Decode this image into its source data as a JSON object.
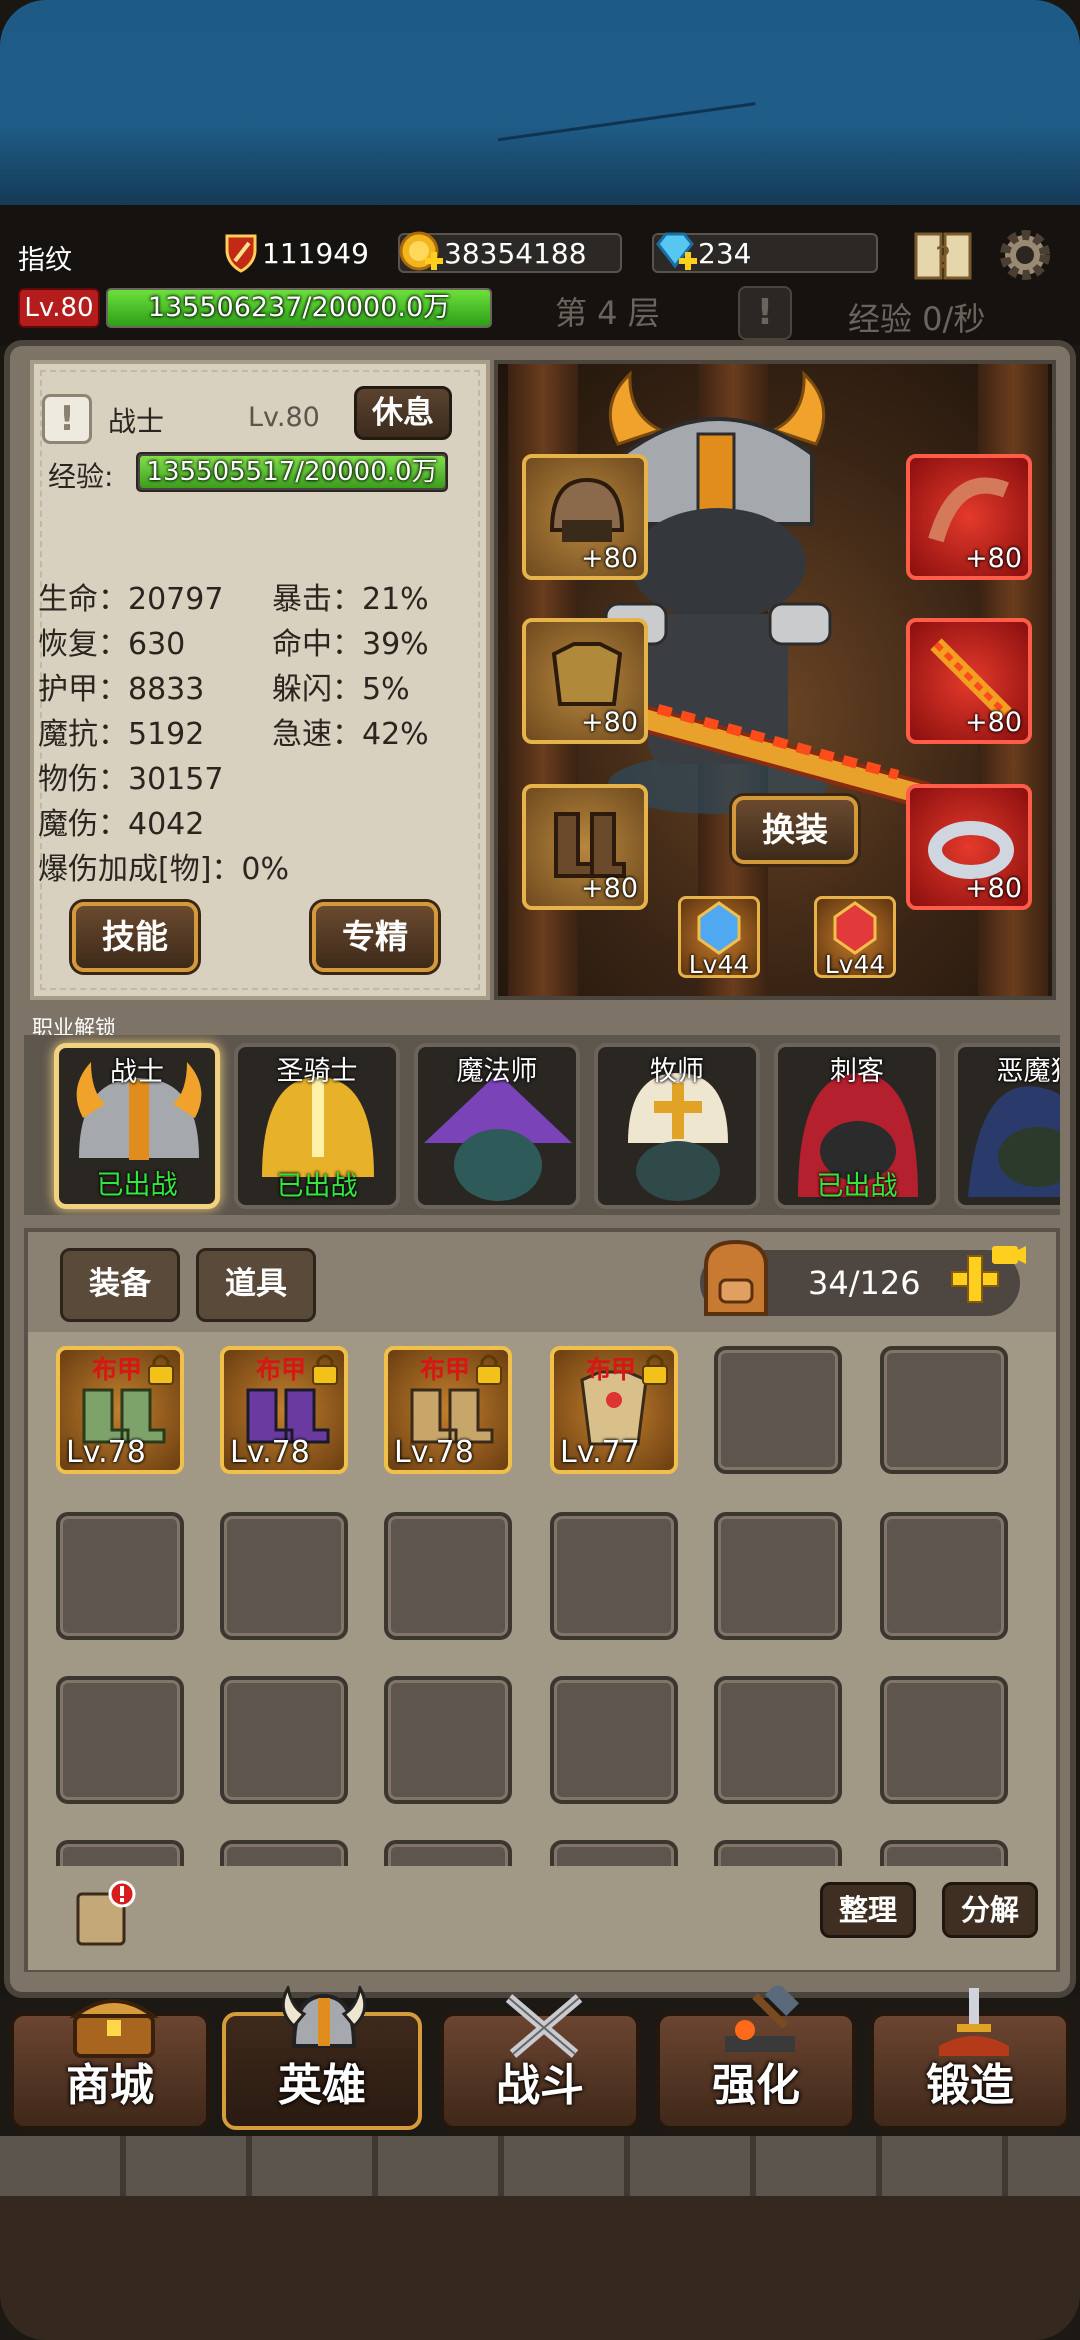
{
  "colors": {
    "accent_gold": "#e6b24a",
    "xp_green": "#33e63b",
    "danger_red": "#b51d1d"
  },
  "header": {
    "player_name": "指纹",
    "power": "111949",
    "gold": "38354188",
    "diamonds": "234",
    "level": "Lv.80",
    "exp_text": "135506237/20000.0万",
    "exp_fill": 1.0,
    "floor": "第 4 层",
    "exp_rate": "经验 0/秒"
  },
  "hero": {
    "class_name": "战士",
    "level": "Lv.80",
    "rest_label": "休息",
    "exp_label": "经验:",
    "exp_text": "135505517/20000.0万",
    "stats_left": [
      "生命：20797",
      "恢复：630",
      "护甲：8833",
      "魔抗：5192",
      "物伤：30157",
      "魔伤：4042",
      "爆伤加成[物]：0%"
    ],
    "stats_right": [
      "暴击：21%",
      "命中：39%",
      "躲闪：5%",
      "急速：42%"
    ],
    "skill_label": "技能",
    "mastery_label": "专精",
    "change_label": "换装",
    "equipment_left": [
      "+80",
      "+80",
      "+80"
    ],
    "equipment_right": [
      "+80",
      "+80",
      "+80"
    ],
    "gems": [
      "Lv44",
      "Lv44"
    ]
  },
  "classes": {
    "title": "职业解锁",
    "items": [
      {
        "name": "战士",
        "status": "已出战"
      },
      {
        "name": "圣骑士",
        "status": "已出战"
      },
      {
        "name": "魔法师",
        "status": ""
      },
      {
        "name": "牧师",
        "status": ""
      },
      {
        "name": "刺客",
        "status": "已出战"
      },
      {
        "name": "恶魔猎",
        "status": ""
      }
    ]
  },
  "bag": {
    "tab_equipment": "装备",
    "tab_items": "道具",
    "count": "34/126",
    "items": [
      {
        "type": "布甲",
        "level": "Lv.78"
      },
      {
        "type": "布甲",
        "level": "Lv.78"
      },
      {
        "type": "布甲",
        "level": "Lv.78"
      },
      {
        "type": "布甲",
        "level": "Lv.77"
      }
    ],
    "sort_label": "整理",
    "decompose_label": "分解"
  },
  "nav": [
    "商城",
    "英雄",
    "战斗",
    "强化",
    "锻造"
  ]
}
